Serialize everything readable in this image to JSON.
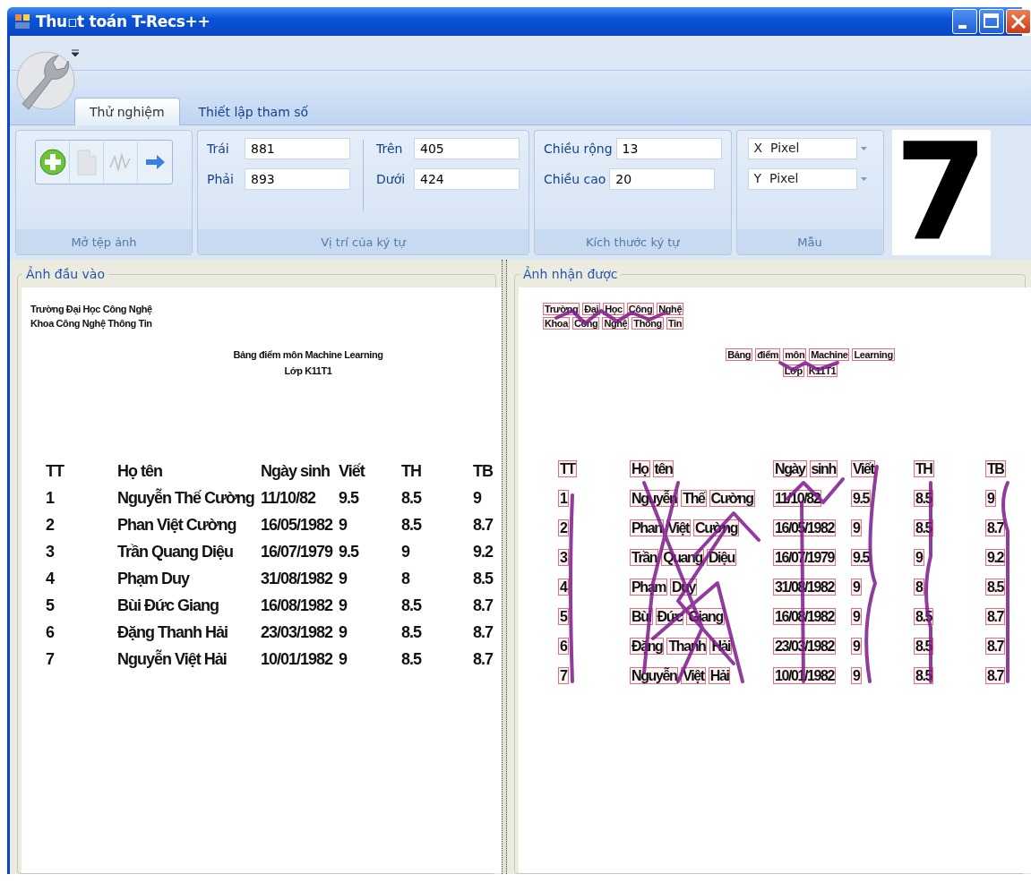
{
  "window": {
    "title": "Thu▫t toán T-Recs++"
  },
  "tabs": [
    {
      "label": "Thử nghiệm",
      "selected": true
    },
    {
      "label": "Thiết lập tham số",
      "selected": false
    }
  ],
  "ribbon": {
    "groups": [
      {
        "title": "Mở tệp ảnh",
        "kind": "tools",
        "buttons": [
          {
            "kind": "add",
            "disabled": false
          },
          {
            "kind": "document",
            "disabled": true
          },
          {
            "kind": "wave",
            "disabled": true
          },
          {
            "kind": "arrow",
            "disabled": false
          }
        ]
      },
      {
        "title": "Vị trí của ký tự",
        "kind": "fields",
        "columns": [
          [
            {
              "label": "Trái",
              "value": "881"
            },
            {
              "label": "Phải",
              "value": "893"
            }
          ],
          [
            {
              "label": "Trên",
              "value": "405"
            },
            {
              "label": "Dưới",
              "value": "424"
            }
          ]
        ]
      },
      {
        "title": "Kích thước ký tự",
        "kind": "fields",
        "columns": [
          [
            {
              "label": "Chiều rộng",
              "value": "13"
            },
            {
              "label": "Chiều cao",
              "value": "20"
            }
          ]
        ]
      },
      {
        "title": "Mẫu",
        "kind": "dropdowns",
        "dropdowns": [
          {
            "value": "X  Pixel"
          },
          {
            "value": "Y  Pixel"
          }
        ]
      }
    ],
    "preview": {
      "character": "7"
    }
  },
  "panels": [
    {
      "title": "Ảnh đầu vào",
      "kind": "plain",
      "document": {
        "header_lines": [
          "Trường Đại Học Công Nghệ",
          "Khoa Công Nghệ Thông Tin"
        ],
        "title_lines": [
          "Bảng điểm môn Machine Learning",
          "Lớp K11T1"
        ],
        "table": {
          "columns": [
            "TT",
            "Họ tên",
            "Ngày sinh",
            "Viết",
            "TH",
            "TB"
          ],
          "rows": [
            [
              "1",
              "Nguyễn Thế Cường",
              "11/10/82",
              "9.5",
              "8.5",
              "9"
            ],
            [
              "2",
              "Phan Việt Cường",
              "16/05/1982",
              "9",
              "8.5",
              "8.7"
            ],
            [
              "3",
              "Trần Quang Diệu",
              "16/07/1979",
              "9.5",
              "9",
              "9.2"
            ],
            [
              "4",
              "Phạm Duy",
              "31/08/1982",
              "9",
              "8",
              "8.5"
            ],
            [
              "5",
              "Bùi Đức Giang",
              "16/08/1982",
              "9",
              "8.5",
              "8.7"
            ],
            [
              "6",
              "Đặng Thanh Hải",
              "23/03/1982",
              "9",
              "8.5",
              "8.7"
            ],
            [
              "7",
              "Nguyễn Việt Hải",
              "10/01/1982",
              "9",
              "8.5",
              "8.7"
            ]
          ]
        }
      }
    },
    {
      "title": "Ảnh nhận được",
      "kind": "boxed",
      "document": {
        "header_lines": [
          "Trường Đại Học Công Nghệ",
          "Khoa Công Nghệ Thông Tin"
        ],
        "title_lines": [
          "Bảng điểm môn Machine Learning",
          "Lớp K11T1"
        ],
        "table": {
          "columns": [
            "TT",
            "Họ tên",
            "Ngày sinh",
            "Viết",
            "TH",
            "TB"
          ],
          "rows": [
            [
              "1",
              "Nguyễn Thế Cường",
              "11/10/82",
              "9.5",
              "8.5",
              "9"
            ],
            [
              "2",
              "Phan Việt Cường",
              "16/05/1982",
              "9",
              "8.5",
              "8.7"
            ],
            [
              "3",
              "Trần Quang Diệu",
              "16/07/1979",
              "9.5",
              "9",
              "9.2"
            ],
            [
              "4",
              "Phạm Duy",
              "31/08/1982",
              "9",
              "8",
              "8.5"
            ],
            [
              "5",
              "Bùi Đức Giang",
              "16/08/1982",
              "9",
              "8.5",
              "8.7"
            ],
            [
              "6",
              "Đặng Thanh Hải",
              "23/03/1982",
              "9",
              "8.5",
              "8.7"
            ],
            [
              "7",
              "Nguyễn Việt Hải",
              "10/01/1982",
              "9",
              "8.5",
              "8.7"
            ]
          ]
        }
      }
    }
  ]
}
